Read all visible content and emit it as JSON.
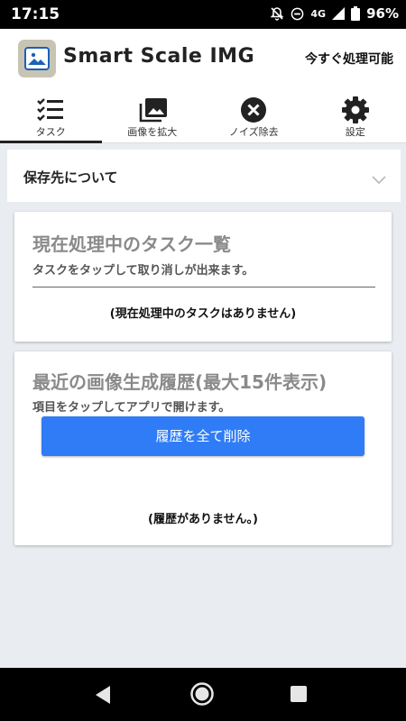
{
  "status_bar": {
    "time": "17:15",
    "network": "4G",
    "battery": "96%",
    "icons": [
      "notifications-off-icon",
      "do-not-disturb-icon",
      "signal-icon",
      "battery-icon"
    ]
  },
  "app_bar": {
    "title": "Smart Scale IMG",
    "action": "今すぐ処理可能",
    "icon": "image-icon"
  },
  "tabs": [
    {
      "label": "タスク",
      "icon": "task-list-icon",
      "active": true
    },
    {
      "label": "画像を拡大",
      "icon": "photo-library-icon",
      "active": false
    },
    {
      "label": "ノイズ除去",
      "icon": "cancel-icon",
      "active": false
    },
    {
      "label": "設定",
      "icon": "gear-icon",
      "active": false
    }
  ],
  "accordion": {
    "label": "保存先について",
    "icon": "chevron-down-icon"
  },
  "current_tasks": {
    "title": "現在処理中のタスク一覧",
    "subtitle": "タスクをタップして取り消しが出来ます。",
    "empty": "(現在処理中のタスクはありません)"
  },
  "history": {
    "title": "最近の画像生成履歴(最大15件表示)",
    "subtitle": "項目をタップしてアプリで開けます。",
    "delete_all": "履歴を全て削除",
    "empty": "(履歴がありません。)"
  },
  "colors": {
    "accent": "#2f7cf6",
    "background": "#e9ecf0"
  }
}
